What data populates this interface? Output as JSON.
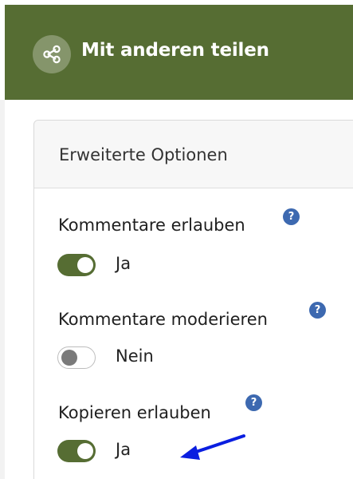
{
  "header": {
    "title": "Mit anderen teilen",
    "icon": "share-icon",
    "background": "#566d33"
  },
  "card": {
    "title": "Erweiterte Optionen"
  },
  "options": [
    {
      "label": "Kommentare erlauben",
      "state": "Ja",
      "enabled": true,
      "help": "?"
    },
    {
      "label": "Kommentare moderieren",
      "state": "Nein",
      "enabled": false,
      "help": "?"
    },
    {
      "label": "Kopieren erlauben",
      "state": "Ja",
      "enabled": true,
      "help": "?"
    }
  ],
  "colors": {
    "toggle_on": "#566d33",
    "help_badge": "#3d69b0",
    "annotation_arrow": "#0a1ee0"
  }
}
